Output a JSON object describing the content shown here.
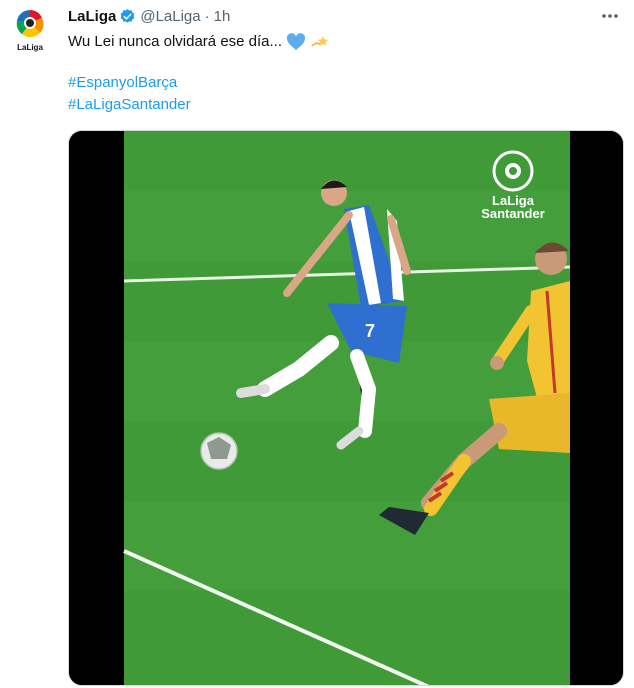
{
  "tweet": {
    "author_name": "LaLiga",
    "handle": "@LaLiga",
    "separator": "·",
    "time": "1h",
    "text": "Wu Lei nunca olvidará ese día...",
    "hashtags": [
      "#EspanyolBarça",
      "#LaLigaSantander"
    ]
  },
  "avatar": {
    "label": "LaLiga"
  },
  "media": {
    "watermark_line1": "LaLiga",
    "watermark_line2": "Santander",
    "player_number": "7"
  },
  "icons": {
    "verified": "verified-badge-icon",
    "more": "more-options-icon",
    "heart": "blue-heart-emoji",
    "star": "dizzy-star-emoji"
  },
  "colors": {
    "accent": "#1d9bf0",
    "text": "#0f1419",
    "muted": "#536471",
    "pitch": "#3f9a37",
    "espanyol_blue": "#2f6fd0",
    "barca_yellow": "#f2c431"
  }
}
